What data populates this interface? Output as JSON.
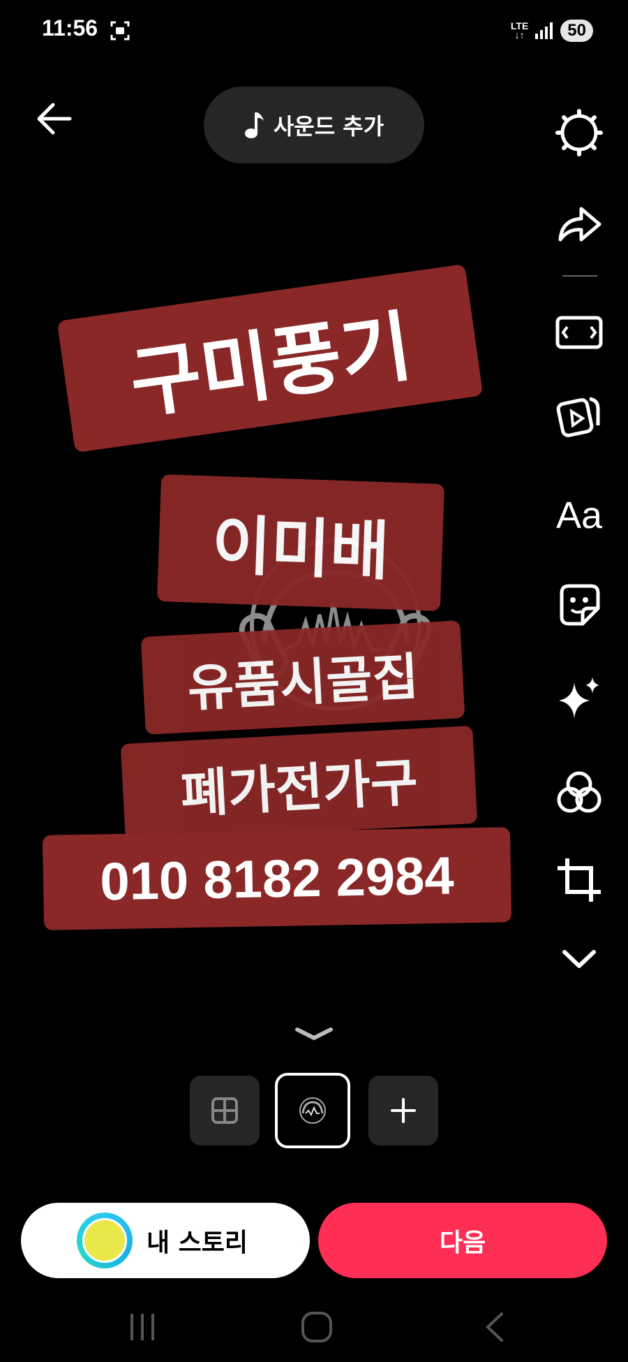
{
  "status_bar": {
    "time": "11:56",
    "network": "LTE",
    "battery": "50"
  },
  "header": {
    "sound_button_label": "사운드 추가"
  },
  "right_toolbar": {
    "tools": [
      "settings-icon",
      "share-icon",
      "aspect-ratio-icon",
      "video-clips-icon",
      "text-tool",
      "sticker-icon",
      "effects-icon",
      "filters-icon",
      "crop-icon",
      "more-chevron-icon"
    ],
    "text_tool_label": "Aa"
  },
  "canvas": {
    "stickers": [
      {
        "text": "구미풍기"
      },
      {
        "text": "이미배"
      },
      {
        "text": "유품시골집"
      },
      {
        "text": "폐가전가구"
      },
      {
        "text": "010 8182 2984"
      }
    ],
    "sticker_color": "#8a2828"
  },
  "bottom": {
    "story_button_label": "내 스토리",
    "next_button_label": "다음",
    "next_color": "#ff2e55"
  }
}
